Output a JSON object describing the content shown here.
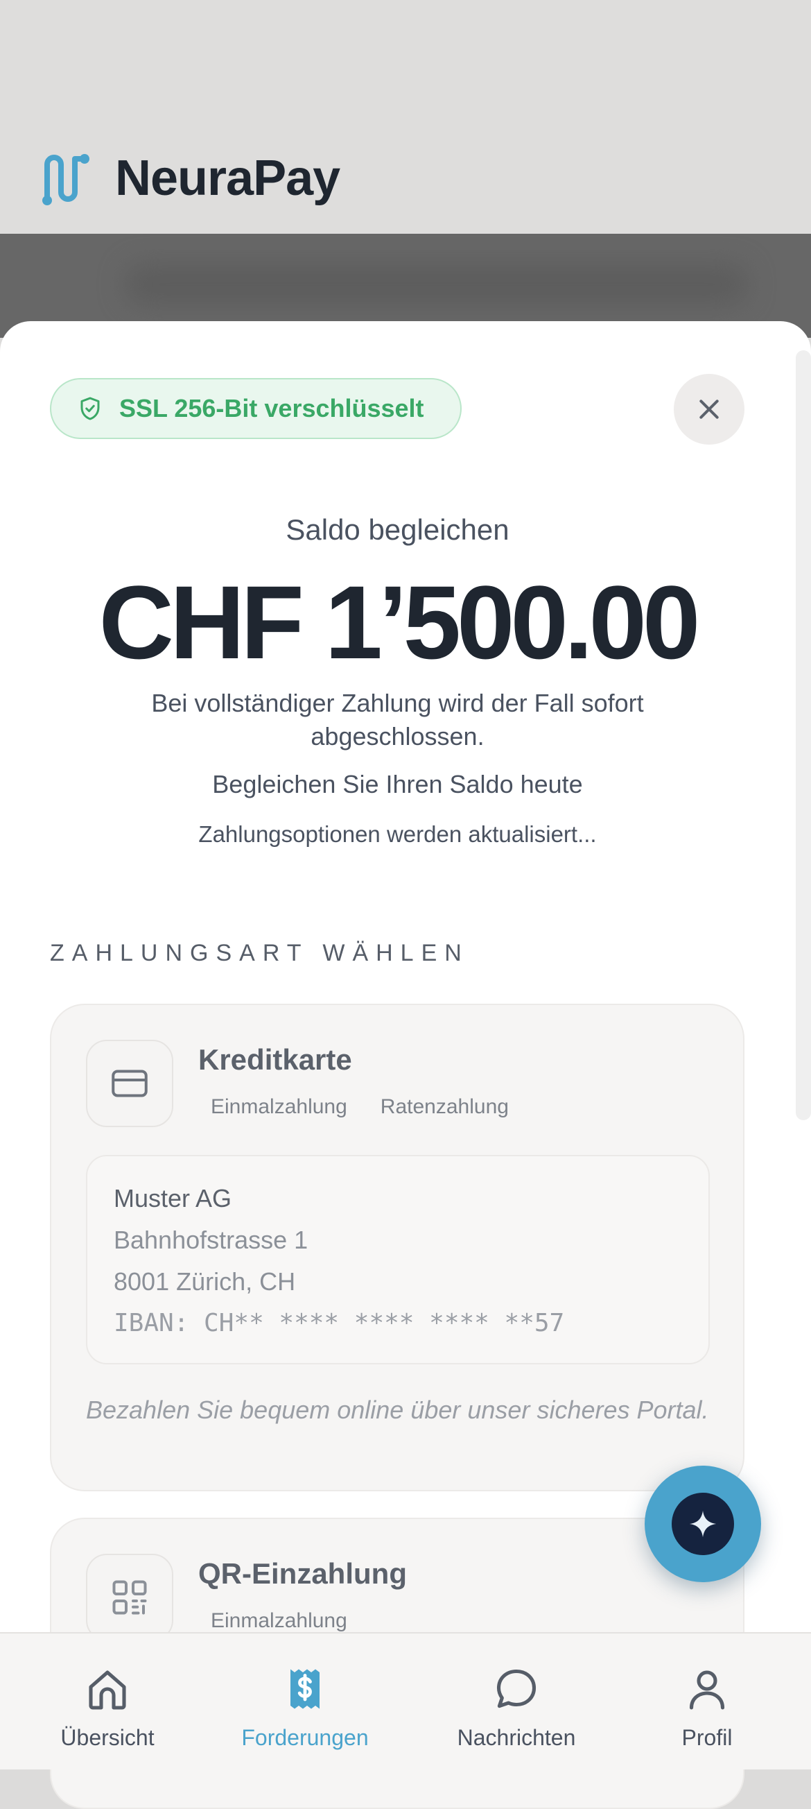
{
  "app": {
    "name": "NeuraPay"
  },
  "security_badge": {
    "label": "SSL 256-Bit verschlüsselt",
    "icon": "shield-check-icon",
    "color": "#3aa866"
  },
  "close": {
    "icon": "close-icon"
  },
  "payment": {
    "subtitle": "Saldo begleichen",
    "amount": "CHF 1’500.00",
    "description": "Bei vollständiger Zahlung wird der Fall sofort abgeschlossen.",
    "call_to_action": "Begleichen Sie Ihren Saldo heute",
    "status": "Zahlungsoptionen werden aktualisiert..."
  },
  "methods": {
    "section_label": "ZAHLUNGSART WÄHLEN",
    "items": [
      {
        "title": "Kreditkarte",
        "icon": "credit-card-icon",
        "options": [
          "Einmalzahlung",
          "Ratenzahlung"
        ],
        "address": {
          "name": "Muster AG",
          "street": "Bahnhofstrasse 1",
          "city": "8001 Zürich, CH",
          "iban": "IBAN: CH** **** **** **** **57"
        },
        "note": "Bezahlen Sie bequem online über unser sicheres Portal."
      },
      {
        "title": "QR-Einzahlung",
        "icon": "qr-code-icon",
        "options": [
          "Einmalzahlung"
        ]
      }
    ]
  },
  "assistant_button": {
    "icon": "sparkle-icon",
    "color": "#4aa3cc"
  },
  "bottom_nav": {
    "active_color": "#4aa3cc",
    "items": [
      {
        "label": "Übersicht",
        "icon": "home-icon",
        "active": false
      },
      {
        "label": "Forderungen",
        "icon": "invoice-dollar-icon",
        "active": true
      },
      {
        "label": "Nachrichten",
        "icon": "chat-bubble-icon",
        "active": false
      },
      {
        "label": "Profil",
        "icon": "user-icon",
        "active": false
      }
    ]
  }
}
